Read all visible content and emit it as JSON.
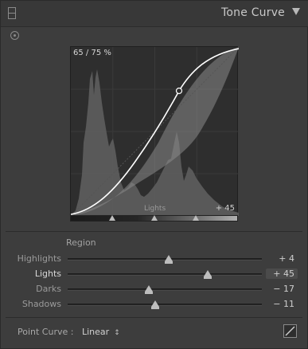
{
  "header": {
    "title": "Tone Curve"
  },
  "graph": {
    "readout": "65 / 75 %",
    "region_label": "Lights",
    "region_value": "+ 45"
  },
  "region": {
    "title": "Region",
    "sliders": [
      {
        "label": "Highlights",
        "value": "+ 4",
        "position": 0.52,
        "active": false
      },
      {
        "label": "Lights",
        "value": "+ 45",
        "position": 0.72,
        "active": true
      },
      {
        "label": "Darks",
        "value": "− 17",
        "position": 0.42,
        "active": false
      },
      {
        "label": "Shadows",
        "value": "− 11",
        "position": 0.45,
        "active": false
      }
    ]
  },
  "split_points": [
    0.25,
    0.5,
    0.75
  ],
  "point_curve": {
    "label": "Point Curve :",
    "value": "Linear",
    "arrows": "↕"
  },
  "colors": {
    "panel": "#3d3d3d",
    "graph_bg": "#2e2e2e",
    "curve": "#ffffff",
    "text": "#a8a8a8"
  }
}
